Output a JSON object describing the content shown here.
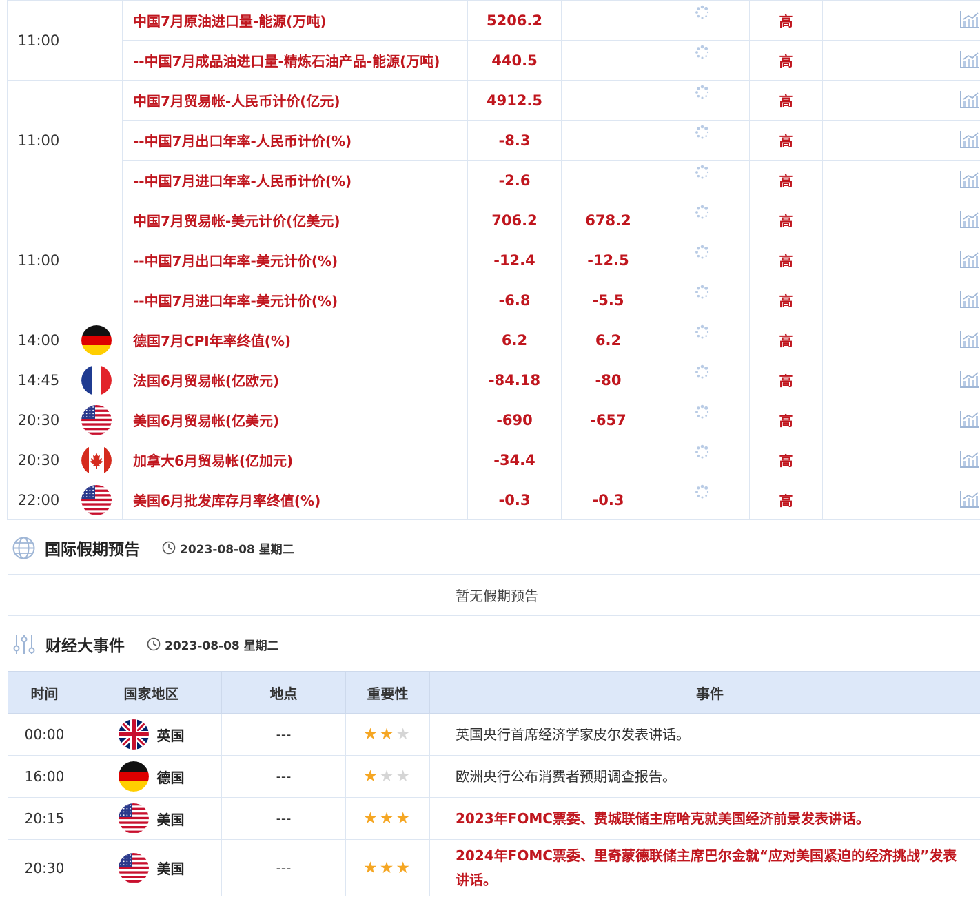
{
  "econ_groups": [
    {
      "time": "11:00",
      "flag": "",
      "rows": [
        {
          "name": "中国7月原油进口量-能源(万吨)",
          "prev": "5206.2",
          "forecast": "",
          "importance": "高"
        },
        {
          "name": "--中国7月成品油进口量-精炼石油产品-能源(万吨)",
          "prev": "440.5",
          "forecast": "",
          "importance": "高"
        }
      ]
    },
    {
      "time": "11:00",
      "flag": "",
      "rows": [
        {
          "name": "中国7月贸易帐-人民币计价(亿元)",
          "prev": "4912.5",
          "forecast": "",
          "importance": "高"
        },
        {
          "name": "--中国7月出口年率-人民币计价(%)",
          "prev": "-8.3",
          "forecast": "",
          "importance": "高"
        },
        {
          "name": "--中国7月进口年率-人民币计价(%)",
          "prev": "-2.6",
          "forecast": "",
          "importance": "高"
        }
      ]
    },
    {
      "time": "11:00",
      "flag": "",
      "rows": [
        {
          "name": "中国7月贸易帐-美元计价(亿美元)",
          "prev": "706.2",
          "forecast": "678.2",
          "importance": "高"
        },
        {
          "name": "--中国7月出口年率-美元计价(%)",
          "prev": "-12.4",
          "forecast": "-12.5",
          "importance": "高"
        },
        {
          "name": "--中国7月进口年率-美元计价(%)",
          "prev": "-6.8",
          "forecast": "-5.5",
          "importance": "高"
        }
      ]
    },
    {
      "time": "14:00",
      "flag": "germany",
      "rows": [
        {
          "name": "德国7月CPI年率终值(%)",
          "prev": "6.2",
          "forecast": "6.2",
          "importance": "高"
        }
      ]
    },
    {
      "time": "14:45",
      "flag": "france",
      "rows": [
        {
          "name": "法国6月贸易帐(亿欧元)",
          "prev": "-84.18",
          "forecast": "-80",
          "importance": "高"
        }
      ]
    },
    {
      "time": "20:30",
      "flag": "usa",
      "rows": [
        {
          "name": "美国6月贸易帐(亿美元)",
          "prev": "-690",
          "forecast": "-657",
          "importance": "高"
        }
      ]
    },
    {
      "time": "20:30",
      "flag": "canada",
      "rows": [
        {
          "name": "加拿大6月贸易帐(亿加元)",
          "prev": "-34.4",
          "forecast": "",
          "importance": "高"
        }
      ]
    },
    {
      "time": "22:00",
      "flag": "usa",
      "rows": [
        {
          "name": "美国6月批发库存月率终值(%)",
          "prev": "-0.3",
          "forecast": "-0.3",
          "importance": "高"
        }
      ]
    }
  ],
  "holiday": {
    "title": "国际假期预告",
    "date": "2023-08-08 星期二",
    "empty_text": "暂无假期预告",
    "icon": "globe-icon"
  },
  "events": {
    "title": "财经大事件",
    "date": "2023-08-08 星期二",
    "icon": "sliders-icon",
    "headers": {
      "time": "时间",
      "country": "国家地区",
      "place": "地点",
      "importance": "重要性",
      "event": "事件"
    },
    "rows": [
      {
        "time": "00:00",
        "flag": "uk",
        "country": "英国",
        "place": "---",
        "stars": 2,
        "event": "英国央行首席经济学家皮尔发表讲话。",
        "highlight": false
      },
      {
        "time": "16:00",
        "flag": "germany",
        "country": "德国",
        "place": "---",
        "stars": 1,
        "event": "欧洲央行公布消费者预期调查报告。",
        "highlight": false
      },
      {
        "time": "20:15",
        "flag": "usa",
        "country": "美国",
        "place": "---",
        "stars": 3,
        "event": "2023年FOMC票委、费城联储主席哈克就美国经济前景发表讲话。",
        "highlight": true
      },
      {
        "time": "20:30",
        "flag": "usa",
        "country": "美国",
        "place": "---",
        "stars": 3,
        "event": "2024年FOMC票委、里奇蒙德联储主席巴尔金就“应对美国紧迫的经济挑战”发表讲话。",
        "highlight": true
      }
    ]
  },
  "colors": {
    "accent_red": "#c0161e",
    "header_bg": "#dde8f9",
    "border": "#dde6f2",
    "star": "#f5a623"
  }
}
